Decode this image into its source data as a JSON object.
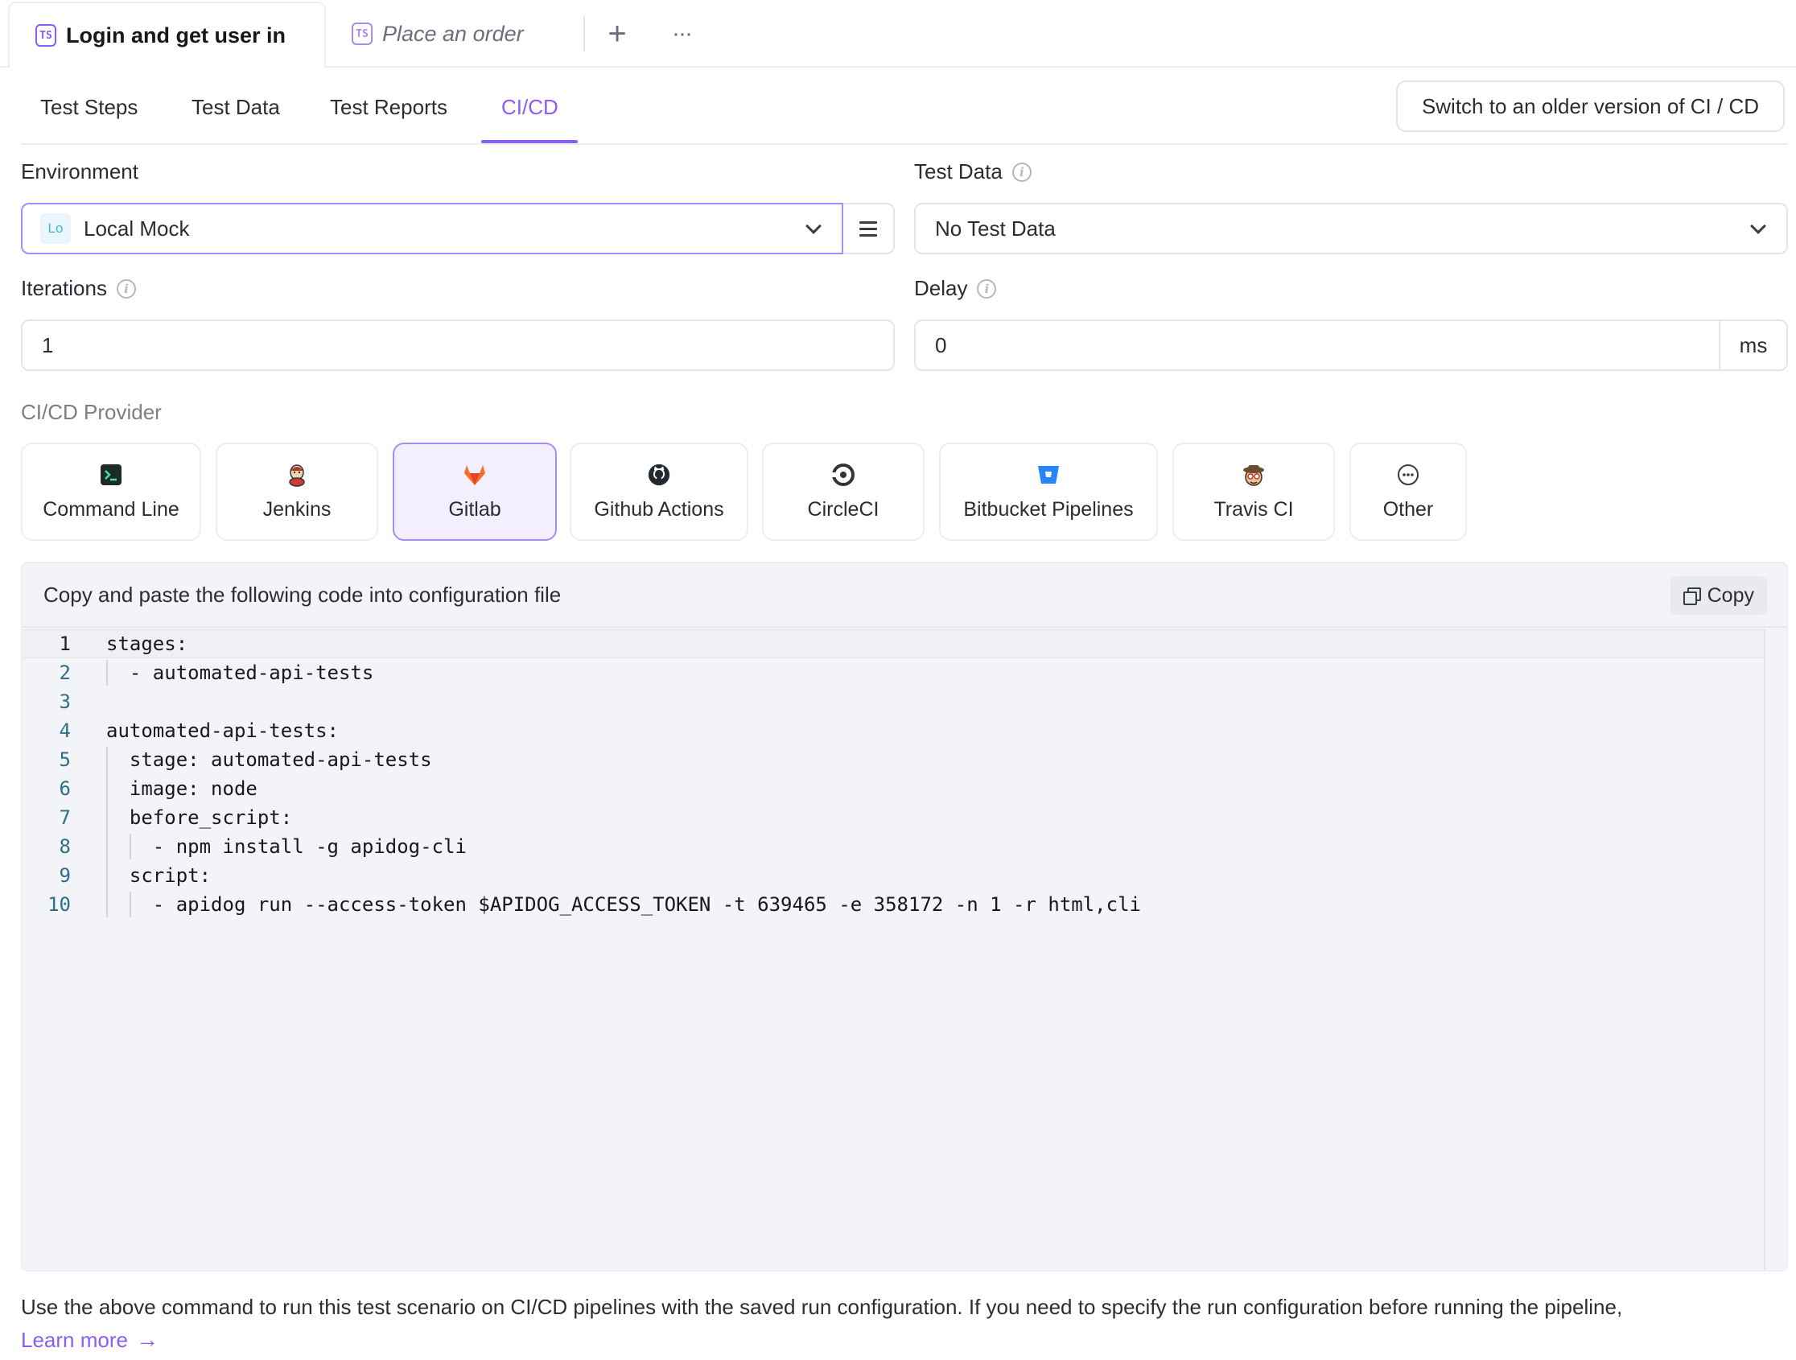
{
  "top_tabs": [
    {
      "label": "Login and get user in",
      "icon": "ts-icon",
      "active": true
    },
    {
      "label": "Place an order",
      "icon": "ts-icon",
      "active": false
    }
  ],
  "ts_badge": "TS",
  "tab_actions": {
    "add": "+",
    "more": "···"
  },
  "sub_tabs": [
    "Test Steps",
    "Test Data",
    "Test Reports",
    "CI/CD"
  ],
  "switch_button": "Switch to an older version of CI / CD",
  "environment": {
    "label": "Environment",
    "avatar": "Lo",
    "value": "Local Mock"
  },
  "test_data": {
    "label": "Test Data",
    "value": "No Test Data"
  },
  "iterations": {
    "label": "Iterations",
    "value": "1"
  },
  "delay": {
    "label": "Delay",
    "value": "0",
    "unit": "ms"
  },
  "provider_section": {
    "label": "CI/CD Provider",
    "items": [
      {
        "label": "Command Line",
        "icon": "terminal-icon"
      },
      {
        "label": "Jenkins",
        "icon": "jenkins-icon"
      },
      {
        "label": "Gitlab",
        "icon": "gitlab-icon",
        "selected": true
      },
      {
        "label": "Github Actions",
        "icon": "github-icon"
      },
      {
        "label": "CircleCI",
        "icon": "circleci-icon"
      },
      {
        "label": "Bitbucket Pipelines",
        "icon": "bitbucket-icon"
      },
      {
        "label": "Travis CI",
        "icon": "travis-icon"
      },
      {
        "label": "Other",
        "icon": "more-circle-icon"
      }
    ]
  },
  "code_panel": {
    "title": "Copy and paste the following code into configuration file",
    "copy_label": "Copy",
    "lines": [
      {
        "n": "1",
        "text": "stages:"
      },
      {
        "n": "2",
        "text": "  - automated-api-tests"
      },
      {
        "n": "3",
        "text": ""
      },
      {
        "n": "4",
        "text": "automated-api-tests:"
      },
      {
        "n": "5",
        "text": "  stage: automated-api-tests"
      },
      {
        "n": "6",
        "text": "  image: node"
      },
      {
        "n": "7",
        "text": "  before_script:"
      },
      {
        "n": "8",
        "text": "    - npm install -g apidog-cli"
      },
      {
        "n": "9",
        "text": "  script:"
      },
      {
        "n": "10",
        "text": "    - apidog run --access-token $APIDOG_ACCESS_TOKEN -t 639465 -e 358172 -n 1 -r html,cli"
      }
    ]
  },
  "footer": {
    "text": "Use the above command to run this test scenario on CI/CD pipelines with the saved run configuration. If you need to specify the run configuration before running the pipeline,",
    "learn_more": "Learn more",
    "arrow": "→"
  },
  "colors": {
    "accent": "#8b5cf6",
    "selected_bg": "#f3efff",
    "code_bg": "#f3f4f7"
  }
}
